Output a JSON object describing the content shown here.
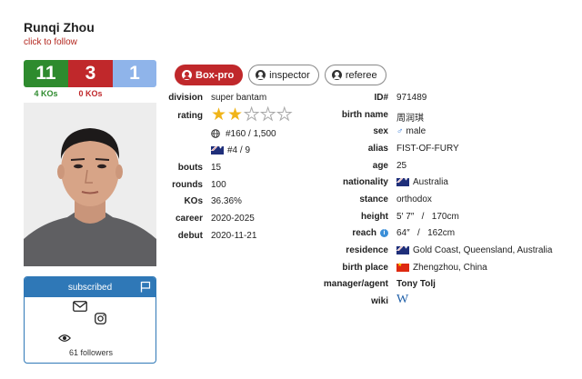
{
  "header": {
    "name": "Runqi Zhou",
    "follow_label": "click to follow"
  },
  "record": {
    "wins": "11",
    "losses": "3",
    "draws": "1",
    "win_kos": "4 KOs",
    "loss_kos": "0 KOs"
  },
  "tabs": [
    {
      "label": "Box-pro",
      "active": true
    },
    {
      "label": "inspector",
      "active": false
    },
    {
      "label": "referee",
      "active": false
    }
  ],
  "profile_left": {
    "division_label": "division",
    "division": "super bantam",
    "rating_label": "rating",
    "rating_stars": 2,
    "rating_max": 5,
    "world_rank": "#160 / 1,500",
    "country_rank": "#4 / 9",
    "bouts_label": "bouts",
    "bouts": "15",
    "rounds_label": "rounds",
    "rounds": "100",
    "kos_label": "KOs",
    "kos": "36.36%",
    "career_label": "career",
    "career": "2020-2025",
    "debut_label": "debut",
    "debut": "2020-11-21"
  },
  "profile_right": {
    "id_label": "ID#",
    "id": "971489",
    "birth_name_label": "birth name",
    "birth_name": "周润琪",
    "sex_label": "sex",
    "sex": "male",
    "alias_label": "alias",
    "alias": "FIST-OF-FURY",
    "age_label": "age",
    "age": "25",
    "nationality_label": "nationality",
    "nationality": "Australia",
    "stance_label": "stance",
    "stance": "orthodox",
    "height_label": "height",
    "height": "5′ 7″   /   170cm",
    "reach_label": "reach",
    "reach": "64″   /   162cm",
    "residence_label": "residence",
    "residence": "Gold Coast, Queensland, Australia",
    "birth_place_label": "birth place",
    "birth_place": "Zhengzhou, China",
    "manager_label": "manager/agent",
    "manager": "Tony Tolj",
    "wiki_label": "wiki",
    "wiki": "W"
  },
  "subscribe": {
    "label": "subscribed",
    "followers": "61 followers"
  },
  "icons": [
    "flag-icon",
    "mail-icon",
    "instagram-icon",
    "eye-icon",
    "globe-icon",
    "info-icon",
    "wikipedia-icon"
  ],
  "colors": {
    "win": "#2e8b2e",
    "loss": "#c0282b",
    "draw": "#8fb4ea",
    "accent": "#2f78b7",
    "star": "#f0b419"
  }
}
